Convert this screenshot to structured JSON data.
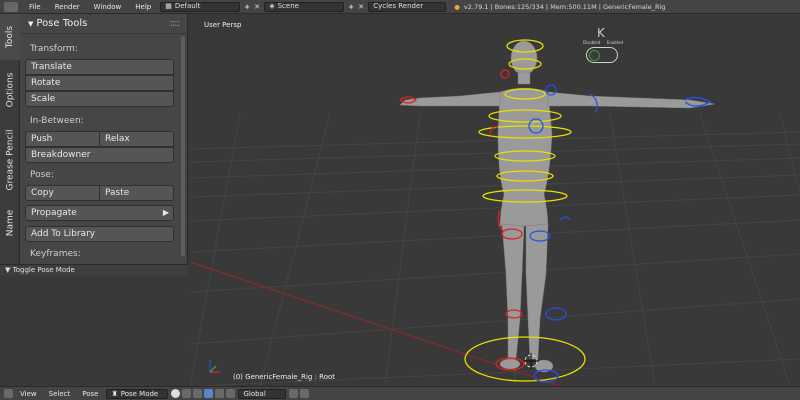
{
  "topbar": {
    "menus": [
      "File",
      "Render",
      "Window",
      "Help"
    ],
    "layout_name": "Default",
    "scene_name": "Scene",
    "render_engine": "Cycles Render",
    "info": "v2.79.1 | Bones:125/334 | Mem:500.11M | GenericFemale_Rig"
  },
  "side_tabs": [
    "Tools",
    "Options",
    "Grease Pencil",
    "Name"
  ],
  "panel": {
    "title": "Pose Tools",
    "transform_label": "Transform:",
    "translate": "Translate",
    "rotate": "Rotate",
    "scale": "Scale",
    "inbetween_label": "In-Between:",
    "push": "Push",
    "relax": "Relax",
    "breakdowner": "Breakdowner",
    "pose_label": "Pose:",
    "copy": "Copy",
    "paste": "Paste",
    "propagate": "Propagate",
    "add_to_library": "Add To Library",
    "keyframes_label": "Keyframes:"
  },
  "toggle_bar": "Toggle Pose Mode",
  "viewport": {
    "view_label": "User Persp",
    "object_label": "(0) GenericFemale_Rig : Root"
  },
  "keyboard_toggle": {
    "logo": "K",
    "label_left": "Disabled",
    "label_right": "Enabled"
  },
  "bottombar": {
    "menus": [
      "View",
      "Select",
      "Pose"
    ],
    "mode": "Pose Mode",
    "orientation": "Global"
  },
  "colors": {
    "rig_yellow": "#e8e000",
    "rig_red": "#e02020",
    "rig_blue": "#2850e8",
    "grid": "#454545",
    "x_axis": "#8a2a2a"
  }
}
